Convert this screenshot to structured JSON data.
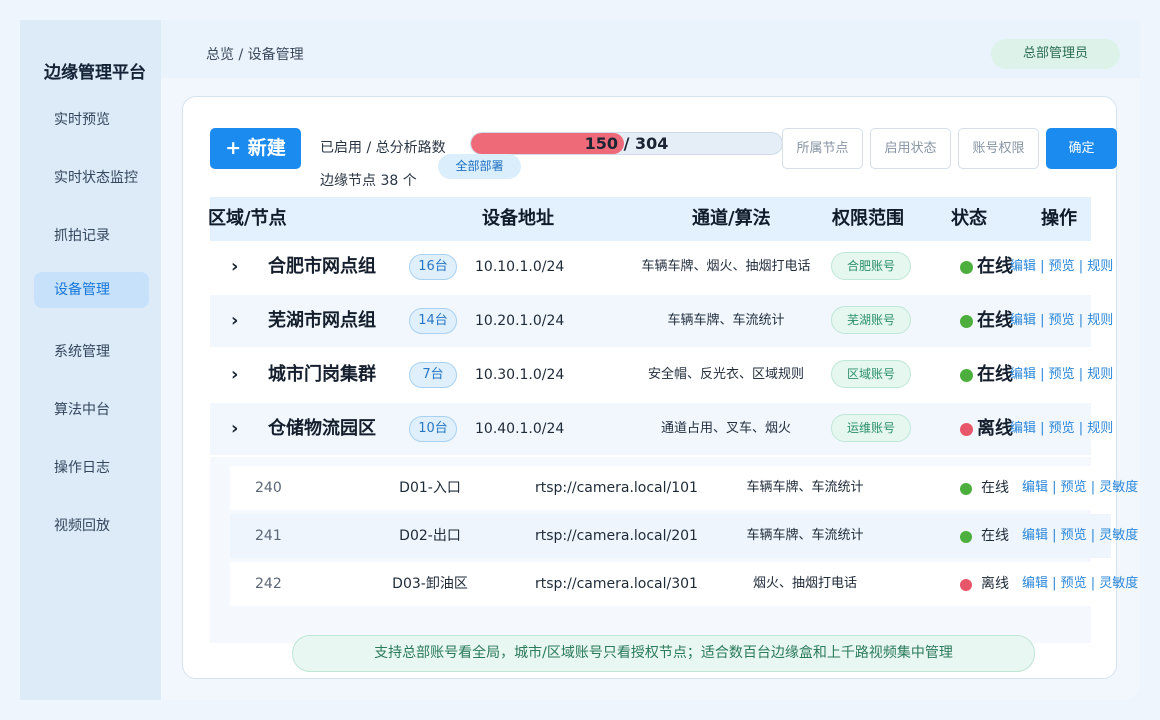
{
  "sidebar": {
    "brand": "边缘管理平台",
    "items": [
      {
        "label": "实时预览"
      },
      {
        "label": "实时状态监控"
      },
      {
        "label": "抓拍记录"
      },
      {
        "label": "设备管理"
      },
      {
        "label": "系统管理"
      },
      {
        "label": "算法中台"
      },
      {
        "label": "操作日志"
      },
      {
        "label": "视频回放"
      }
    ],
    "active_index": 3
  },
  "header": {
    "breadcrumb": "总览 / 设备管理",
    "role": "总部管理员"
  },
  "toolbar": {
    "new_label": "+ 新建",
    "stat_label": "已启用 / 总分析路数",
    "enabled": 150,
    "total": 304,
    "progress_text": "150 / 304",
    "scope_chip": "全部部署",
    "node_count": "边缘节点 38 个",
    "filters": [
      "所属节点",
      "启用状态",
      "账号权限"
    ],
    "confirm_label": "确定"
  },
  "table": {
    "headers": [
      "区域/节点",
      "设备地址",
      "通道/算法",
      "权限范围",
      "状态",
      "操作"
    ],
    "groups": [
      {
        "chevron": "›",
        "name": "合肥市网点组",
        "count": "16台",
        "address": "10.10.1.0/24",
        "algo": "车辆车牌、烟火、抽烟打电话",
        "perm": "合肥账号",
        "status": "在线",
        "online": true,
        "ops": "编辑 | 预览 | 规则"
      },
      {
        "chevron": "›",
        "name": "芜湖市网点组",
        "count": "14台",
        "address": "10.20.1.0/24",
        "algo": "车辆车牌、车流统计",
        "perm": "芜湖账号",
        "status": "在线",
        "online": true,
        "ops": "编辑 | 预览 | 规则"
      },
      {
        "chevron": "›",
        "name": "城市门岗集群",
        "count": "7台",
        "address": "10.30.1.0/24",
        "algo": "安全帽、反光衣、区域规则",
        "perm": "区域账号",
        "status": "在线",
        "online": true,
        "ops": "编辑 | 预览 | 规则"
      },
      {
        "chevron": "›",
        "name": "仓储物流园区",
        "count": "10台",
        "address": "10.40.1.0/24",
        "algo": "通道占用、叉车、烟火",
        "perm": "运维账号",
        "status": "离线",
        "online": false,
        "ops": "编辑 | 预览 | 规则"
      }
    ],
    "sub_rows": [
      {
        "id": "240",
        "name": "D01-入口",
        "url": "rtsp://camera.local/101",
        "algo": "车辆车牌、车流统计",
        "status": "在线",
        "online": true,
        "ops": "编辑 | 预览 | 灵敏度"
      },
      {
        "id": "241",
        "name": "D02-出口",
        "url": "rtsp://camera.local/201",
        "algo": "车辆车牌、车流统计",
        "status": "在线",
        "online": true,
        "ops": "编辑 | 预览 | 灵敏度"
      },
      {
        "id": "242",
        "name": "D03-卸油区",
        "url": "rtsp://camera.local/301",
        "algo": "烟火、抽烟打电话",
        "status": "离线",
        "online": false,
        "ops": "编辑 | 预览 | 灵敏度"
      }
    ]
  },
  "footer_note": "支持总部账号看全局，城市/区域账号只看授权节点；适合数百台边缘盒和上千路视频集中管理",
  "colors": {
    "accent": "#1b8bf0",
    "online": "#4caf3d",
    "offline": "#e8566a",
    "progress": "#ef6a78"
  }
}
